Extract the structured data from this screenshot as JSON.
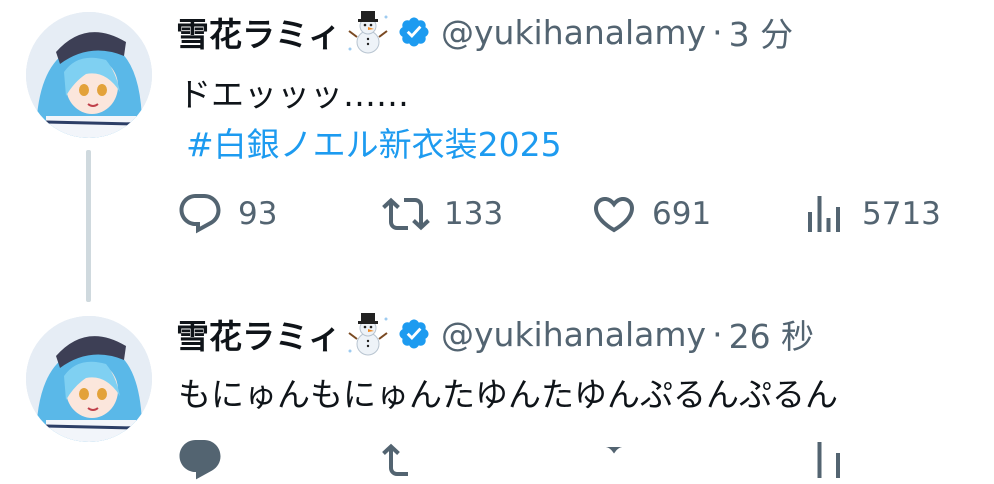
{
  "tweets": [
    {
      "author_name": "雪花ラミィ",
      "author_emoji": "snowman-emoji",
      "verified": true,
      "handle": "@yukihanalamy",
      "separator": "·",
      "time": "3 分",
      "text": "ドエッッッ……",
      "hashtag": "#白銀ノエル新衣装2025",
      "stats": {
        "replies": "93",
        "retweets": "133",
        "likes": "691",
        "views": "5713"
      }
    },
    {
      "author_name": "雪花ラミィ",
      "author_emoji": "snowman-emoji",
      "verified": true,
      "handle": "@yukihanalamy",
      "separator": "·",
      "time": "26 秒",
      "text": "もにゅんもにゅんたゆんたゆんぷるんぷるん"
    }
  ],
  "colors": {
    "text": "#0f1419",
    "secondary": "#536471",
    "accent": "#1d9bf0",
    "thread_line": "#cfd9de"
  },
  "icons": [
    "avatar",
    "snowman-emoji",
    "verified-badge-icon",
    "reply-icon",
    "retweet-icon",
    "like-icon",
    "views-icon"
  ]
}
